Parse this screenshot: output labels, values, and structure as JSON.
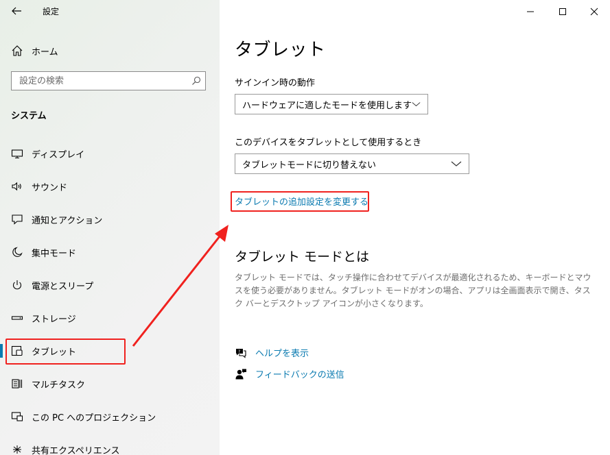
{
  "window": {
    "title": "設定",
    "controls": [
      "minimize",
      "maximize",
      "close"
    ]
  },
  "nav": {
    "back_icon": "back-arrow-icon",
    "home_label": "ホーム",
    "search_placeholder": "設定の検索",
    "section": "システム",
    "items": [
      {
        "label": "ディスプレイ",
        "icon": "display-icon"
      },
      {
        "label": "サウンド",
        "icon": "speaker-icon"
      },
      {
        "label": "通知とアクション",
        "icon": "notification-icon"
      },
      {
        "label": "集中モード",
        "icon": "moon-icon"
      },
      {
        "label": "電源とスリープ",
        "icon": "power-icon"
      },
      {
        "label": "ストレージ",
        "icon": "storage-icon"
      },
      {
        "label": "タブレット",
        "icon": "tablet-icon",
        "selected": true
      },
      {
        "label": "マルチタスク",
        "icon": "multitask-icon"
      },
      {
        "label": "この PC へのプロジェクション",
        "icon": "projection-icon"
      },
      {
        "label": "共有エクスペリエンス",
        "icon": "share-icon"
      }
    ]
  },
  "main": {
    "title": "タブレット",
    "signin_label": "サインイン時の動作",
    "signin_value": "ハードウェアに適したモードを使用します",
    "device_label": "このデバイスをタブレットとして使用するとき",
    "device_value": "タブレットモードに切り替えない",
    "additional_link": "タブレットの追加設定を変更する",
    "about_title": "タブレット モードとは",
    "about_desc": "タブレット モードでは、タッチ操作に合わせてデバイスが最適化されるため、キーボードとマウスを使う必要がありません。タブレット モードがオンの場合、アプリは全画面表示で開き、タスク バーとデスクトップ アイコンが小さくなります。",
    "help_label": "ヘルプを表示",
    "feedback_label": "フィードバックの送信"
  },
  "colors": {
    "accent": "#0a7ab0",
    "annotation": "#f0211e",
    "nav_bg": "#eef1ee"
  }
}
